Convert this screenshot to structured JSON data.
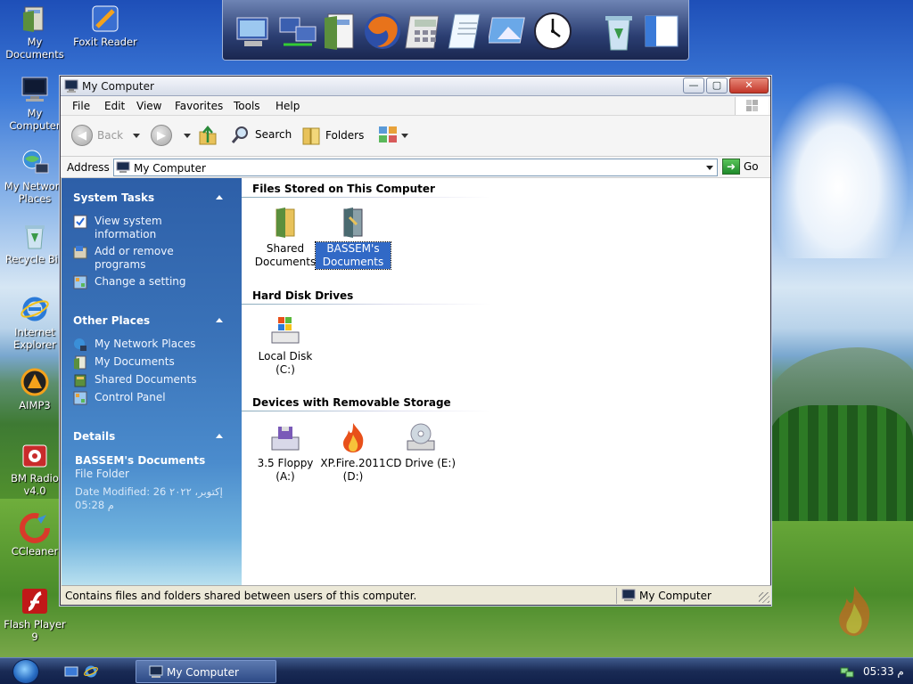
{
  "desktop": {
    "icons": [
      {
        "label": "My Documents",
        "icon": "my-documents-icon"
      },
      {
        "label": "Foxit Reader",
        "icon": "foxit-reader-icon"
      },
      {
        "label": "My Computer",
        "icon": "my-computer-icon"
      },
      {
        "label": "My Network Places",
        "icon": "network-places-icon"
      },
      {
        "label": "Recycle Bin",
        "icon": "recycle-bin-icon"
      },
      {
        "label": "Internet Explorer",
        "icon": "internet-explorer-icon"
      },
      {
        "label": "AIMP3",
        "icon": "aimp3-icon"
      },
      {
        "label": "BM Radio v4.0",
        "icon": "bm-radio-icon"
      },
      {
        "label": "CCleaner",
        "icon": "ccleaner-icon"
      },
      {
        "label": "Flash Player 9",
        "icon": "flash-player-icon"
      }
    ],
    "dock_items": [
      "my-computer-icon",
      "network-icon",
      "documents-icon",
      "firefox-icon",
      "calculator-icon",
      "notepad-icon",
      "image-viewer-icon",
      "clock-icon",
      "recycle-bin-icon",
      "window-icon"
    ]
  },
  "window": {
    "title": "My Computer",
    "buttons": {
      "minimize": "—",
      "maximize": "▢",
      "close": "✕"
    },
    "menu": [
      "File",
      "Edit",
      "View",
      "Favorites",
      "Tools",
      "Help"
    ],
    "toolbar": {
      "back": "Back",
      "search": "Search",
      "folders": "Folders"
    },
    "address": {
      "label": "Address",
      "value": "My Computer",
      "go": "Go"
    },
    "left_pane": {
      "system_tasks": {
        "title": "System Tasks",
        "items": [
          "View system information",
          "Add or remove programs",
          "Change a setting"
        ]
      },
      "other_places": {
        "title": "Other Places",
        "items": [
          "My Network Places",
          "My Documents",
          "Shared Documents",
          "Control Panel"
        ]
      },
      "details": {
        "title": "Details",
        "name": "BASSEM's Documents",
        "type": "File Folder",
        "modified": "Date Modified: 26 إكتوبر، ٢٠٢٢",
        "time": "05:28 م"
      }
    },
    "groups": {
      "files_stored": {
        "title": "Files Stored on This Computer",
        "items": [
          {
            "label": "Shared Documents"
          },
          {
            "label": "BASSEM's Documents"
          }
        ]
      },
      "hard_disks": {
        "title": "Hard Disk Drives",
        "items": [
          {
            "label": "Local Disk (C:)"
          }
        ]
      },
      "removable": {
        "title": "Devices with Removable Storage",
        "items": [
          {
            "label": "3.5 Floppy (A:)"
          },
          {
            "label": "XP.Fire.2011 (D:)"
          },
          {
            "label": "CD Drive (E:)"
          }
        ]
      }
    },
    "status": {
      "text": "Contains files and folders shared between users of this computer.",
      "location": "My Computer"
    }
  },
  "taskbar": {
    "task": "My Computer",
    "clock": "05:33 م"
  }
}
